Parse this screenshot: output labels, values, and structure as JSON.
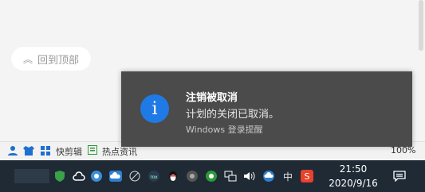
{
  "browser": {
    "back_to_top": {
      "label": "回到顶部"
    }
  },
  "statusbar": {
    "item_edit": "快剪辑",
    "item_news": "热点资讯",
    "zoom": "100%"
  },
  "toast": {
    "title": "注销被取消",
    "message": "计划的关闭已取消。",
    "source": "Windows 登录提醒",
    "icon": "info-icon",
    "accent_color": "#1f7ae6"
  },
  "taskbar": {
    "ime_label": "中",
    "time": "21:50",
    "date": "2020/9/16"
  }
}
